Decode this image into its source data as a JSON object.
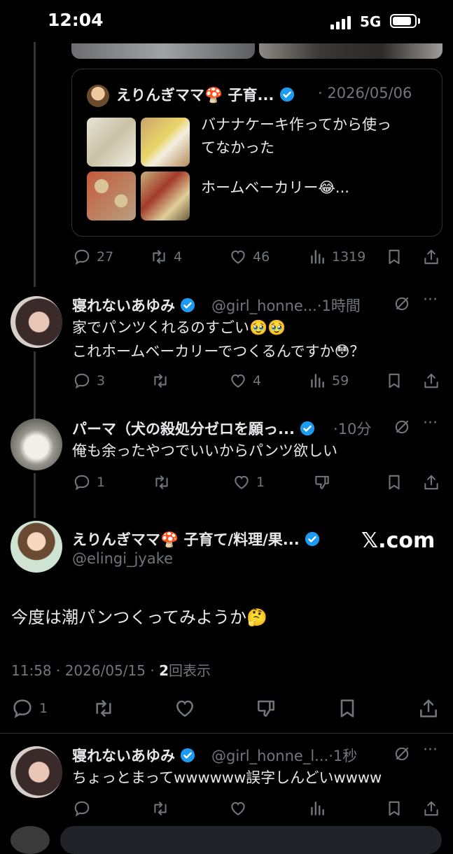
{
  "status_bar": {
    "time": "12:04",
    "network": "5G"
  },
  "quote_tweet": {
    "author": "えりんぎママ🍄 子育...",
    "date": "2026/05/06",
    "text_line1": "バナナケーキ作ってから使っ",
    "text_line2": "てなかった",
    "text_line3": "ホームベーカリー😂..."
  },
  "parent_actions": {
    "replies": "27",
    "retweets": "4",
    "likes": "46",
    "views": "1319"
  },
  "reply1": {
    "name": "寝れないあゆみ",
    "handle": "@girl_honne...",
    "time": "1時間",
    "line1": "家でパンツくれるのすごい🥹🥹",
    "line2": "これホームベーカリーでつくるんですか😳？",
    "replies": "3",
    "retweets": "",
    "likes": "4",
    "views": "59"
  },
  "reply2": {
    "name": "パーマ（犬の殺処分ゼロを願っ...",
    "time": "10分",
    "line1": "俺も余ったやつでいいからパンツ欲しい",
    "replies": "1",
    "retweets": "",
    "likes": "1"
  },
  "main_tweet": {
    "name": "えりんぎママ🍄 子育て/料理/果...",
    "handle": "@elingi_jyake",
    "watermark": "𝕏.com",
    "text": "今度は潮パンつくってみようか🤔",
    "timestamp": "11:58 · 2026/05/15 · ",
    "views_count": "2",
    "views_label": "回表示",
    "replies": "1"
  },
  "reply3": {
    "name": "寝れないあゆみ",
    "handle": "@girl_honne_l...",
    "time": "1秒",
    "line1": "ちょっとまってwwwwww誤字しんどいwwww"
  }
}
